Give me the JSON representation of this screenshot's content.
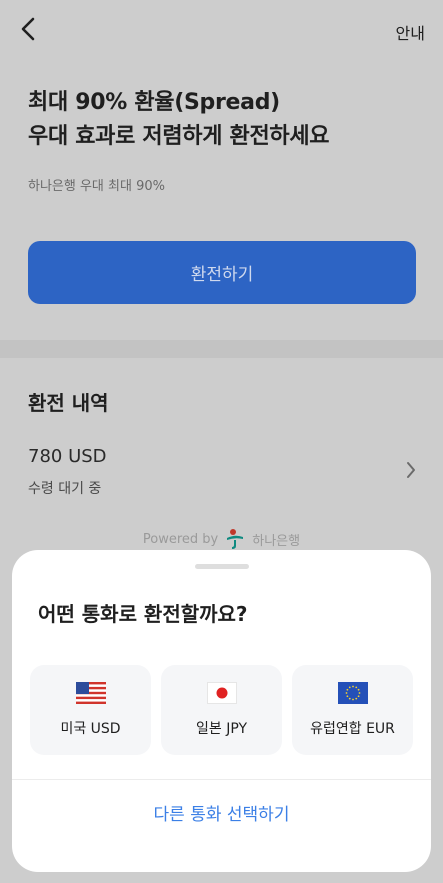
{
  "header": {
    "back_icon": "chevron-left-icon",
    "info_label": "안내"
  },
  "hero": {
    "line1": "최대 90% 환율(Spread)",
    "line2": "우대 효과로 저렴하게 환전하세요",
    "subtext": "하나은행 우대 최대 90%",
    "button_label": "환전하기",
    "button_color": "#2d64c4"
  },
  "history": {
    "title": "환전 내역",
    "items": [
      {
        "amount": "780 USD",
        "status": "수령 대기 중"
      }
    ]
  },
  "powered": {
    "prefix": "Powered by",
    "bank": "하나은행",
    "logo_icon": "hana-bank-logo-icon"
  },
  "sheet": {
    "title": "어떤 통화로 환전할까요?",
    "currencies": [
      {
        "label": "미국 USD",
        "flag": "us-flag-icon"
      },
      {
        "label": "일본 JPY",
        "flag": "japan-flag-icon"
      },
      {
        "label": "유럽연합 EUR",
        "flag": "eu-flag-icon"
      }
    ],
    "other_label": "다른 통화 선택하기",
    "accent_color": "#3b7fe6"
  }
}
